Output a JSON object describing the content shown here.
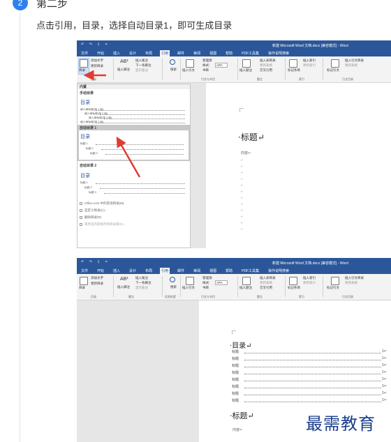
{
  "step": {
    "number": "2",
    "title": "第二步",
    "instruction": "点击引用，目录，选择自动目录1，即可生成目录"
  },
  "word": {
    "doc_title": "新建 Microsoft Word 文档.docx [兼容模式] - Word",
    "quick_access": "↶ ↷ ⇩ =",
    "tabs": [
      "文件",
      "开始",
      "插入",
      "设计",
      "布局",
      "引用",
      "邮件",
      "审阅",
      "视图",
      "帮助",
      "PDF工具集",
      "操作说明搜索"
    ],
    "active_tab": "引用",
    "ribbon": {
      "toc_button": "目录",
      "add_text": "添加文字",
      "update_table": "更新目录",
      "ab_label": "AB¹",
      "insert_footnote": "插入脚注",
      "insert_endnote": "插入尾注",
      "next_footnote": "下一条脚注",
      "show_notes": "显示备注",
      "search": "搜索",
      "insert_citation": "插入引文",
      "manage_sources": "管理源",
      "style_label": "样式:",
      "style_value": "APA",
      "bibliography": "书目",
      "insert_caption": "插入题注",
      "insert_table_of_figures": "插入表目录",
      "update_table2": "更新表格",
      "cross_reference": "交叉引用",
      "mark_entry": "标记条目",
      "insert_index": "插入索引",
      "update_index": "更新索引",
      "mark_citation": "标记引文",
      "insert_table_of_authorities": "插入引文目录",
      "update_table3": "更新表格",
      "groups": [
        "目录",
        "脚注",
        "信息检索",
        "引文与书目",
        "题注",
        "索引",
        "引文目录"
      ]
    }
  },
  "dropdown": {
    "header": "内置",
    "manual_label": "手动目录",
    "auto1_label": "自动目录 1",
    "auto2_label": "自动目录 2",
    "toc_title": "目录",
    "manual_lines": [
      "键入章标题(第 1 级)",
      "键入章标题(第 2 级)",
      "键入章标题(第 3 级)",
      "键入章标题(第 1 级)"
    ],
    "auto_lines": [
      "标题 1",
      "标题 2",
      "标题 3"
    ],
    "more_online": "Office.com 中的其他目录(M)",
    "custom_toc": "自定义目录(C)...",
    "remove_toc": "删除目录(R)",
    "save_selection": "将所选内容保存到目录库(S)..."
  },
  "document1": {
    "heading": "·标题↵",
    "sub": "内容↵"
  },
  "document2": {
    "toc_heading": "·目录↵",
    "toc_entries": [
      {
        "label": "标题",
        "page": "1↵"
      },
      {
        "label": "标题",
        "page": "1↵"
      },
      {
        "label": "标题",
        "page": "1↵"
      },
      {
        "label": "标题",
        "page": "1↵"
      },
      {
        "label": "标题",
        "page": "1↵"
      },
      {
        "label": "标题",
        "page": "1↵"
      },
      {
        "label": "标题",
        "page": "1↵"
      },
      {
        "label": "标题",
        "page": "1↵"
      }
    ],
    "heading": "·标题↵",
    "sub": "内容↵"
  },
  "watermark": "最需教育",
  "colors": {
    "accent": "#2b579a",
    "badge": "#2f80ed",
    "arrow": "#e03c31"
  }
}
